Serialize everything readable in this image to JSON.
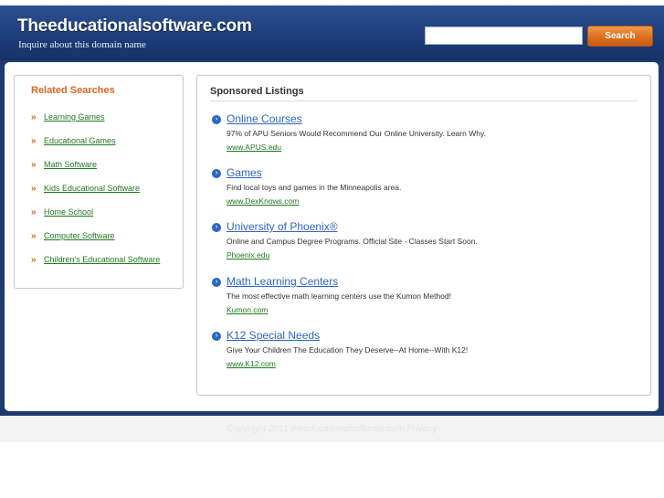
{
  "header": {
    "site_title": "Theeducationalsoftware.com",
    "subtitle": "Inquire about this domain name",
    "search": {
      "value": "",
      "button_label": "Search"
    }
  },
  "related": {
    "title": "Related Searches",
    "arrow_glyph": "»",
    "items": [
      {
        "label": "Learning Games"
      },
      {
        "label": "Educational Games"
      },
      {
        "label": "Math Software"
      },
      {
        "label": "Kids Educational Software"
      },
      {
        "label": "Home School"
      },
      {
        "label": "Computer Software"
      },
      {
        "label": "Children's Educational Software"
      }
    ]
  },
  "sponsored": {
    "title": "Sponsored Listings",
    "bullet_glyph": "›",
    "listings": [
      {
        "title": "Online Courses",
        "description": "97% of APU Seniors Would Recommend Our Online University. Learn Why.",
        "url": "www.APUS.edu"
      },
      {
        "title": "Games",
        "description": "Find local toys and games in the Minneapolis area.",
        "url": "www.DexKnows.com"
      },
      {
        "title": "University of Phoenix®",
        "description": "Online and Campus Degree Programs. Official Site - Classes Start Soon.",
        "url": "Phoenix.edu"
      },
      {
        "title": "Math Learning Centers",
        "description": "The most effective math learning centers use the Kumon Method!",
        "url": "Kumon.com"
      },
      {
        "title": "K12 Special Needs",
        "description": "Give Your Children The Education They Deserve--At Home--With K12!",
        "url": "www.K12.com"
      }
    ]
  },
  "footer": {
    "copyright": "Copyright 2011 theeducationalsoftware.com Privacy"
  },
  "colors": {
    "header_bg": "#1d3d7b",
    "accent_orange": "#d9681f",
    "link_green": "#1f7a1f",
    "link_blue": "#2e66c0"
  }
}
